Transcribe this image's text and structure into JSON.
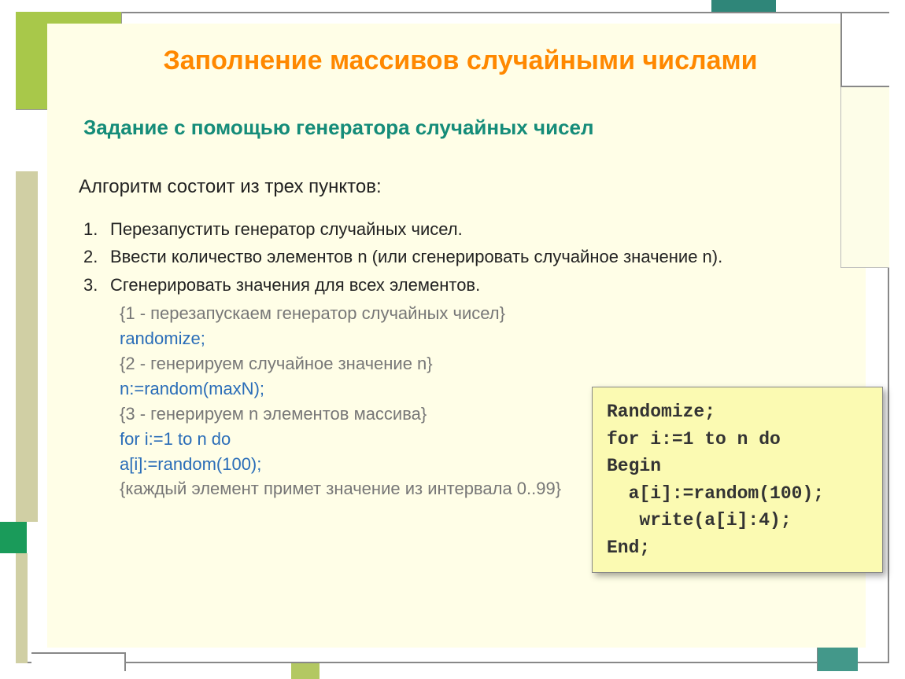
{
  "title": "Заполнение массивов случайными числами",
  "subtitle": "Задание с помощью генератора случайных чисел",
  "intro": "Алгоритм состоит из трех пунктов:",
  "items": [
    {
      "n": "1.",
      "t": "Перезапустить генератор случайных чисел."
    },
    {
      "n": "2.",
      "t": "Ввести количество элементов n (или сгенерировать случайное значение n)."
    },
    {
      "n": "3.",
      "t": "Сгенерировать значения для всех элементов."
    }
  ],
  "steps": [
    {
      "c": "{1 - перезапускаем генератор случайных чисел}",
      "cls": "code-gray"
    },
    {
      "c": "randomize;",
      "cls": "code-blue"
    },
    {
      "c": "{2 - генерируем случайное значение n}",
      "cls": "code-gray"
    },
    {
      "c": "n:=random(maxN);",
      "cls": "code-blue"
    },
    {
      "c": "{3 - генерируем n элементов массива}",
      "cls": "code-gray"
    },
    {
      "c": "for i:=1 to n do",
      "cls": "code-blue"
    },
    {
      "c": "a[i]:=random(100);",
      "cls": "code-blue"
    },
    {
      "c": "{каждый элемент примет значение из интервала 0..99}",
      "cls": "code-gray"
    }
  ],
  "codebox": "Randomize;\nfor i:=1 to n do\nBegin\n  a[i]:=random(100);\n   write(a[i]:4);\nEnd;"
}
